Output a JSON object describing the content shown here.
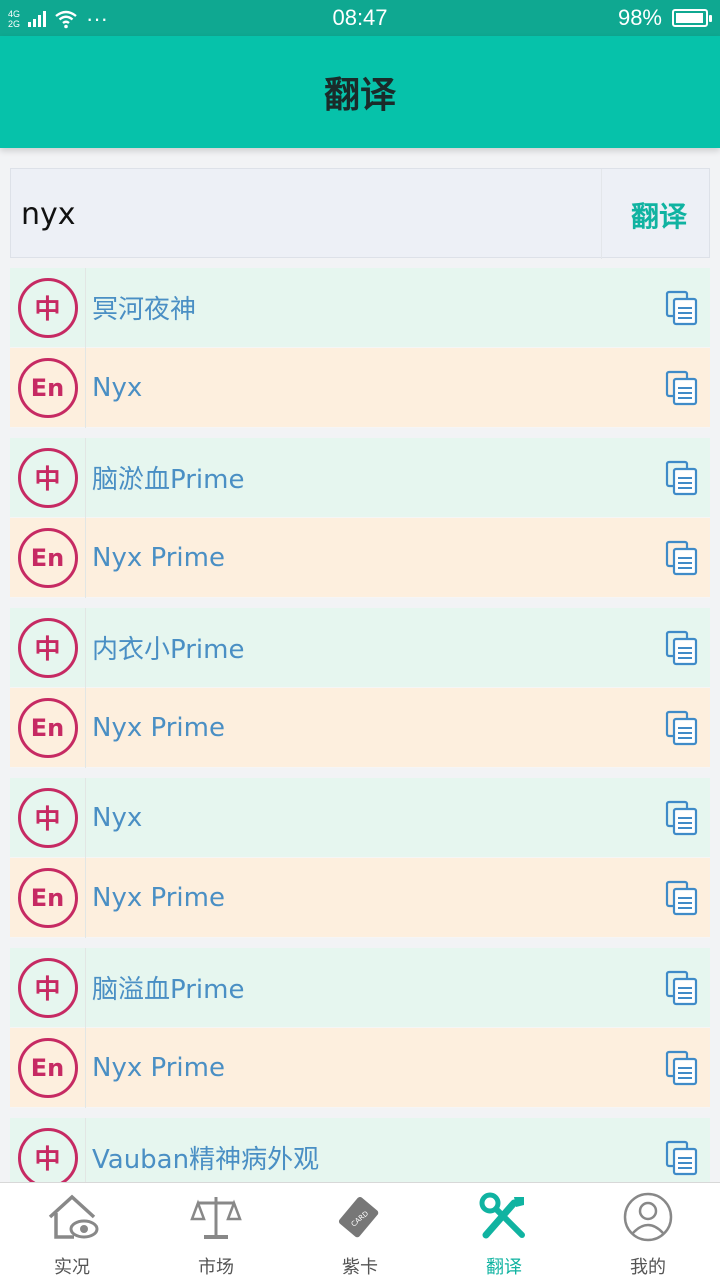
{
  "status_bar": {
    "network_top": "4G",
    "network_bottom": "2G",
    "dots": "···",
    "time": "08:47",
    "battery": "98%",
    "battery_level": 0.98
  },
  "header": {
    "title": "翻译"
  },
  "search": {
    "query": "nyx",
    "button_label": "翻译"
  },
  "results": [
    {
      "zh": "冥河夜神",
      "en": "Nyx"
    },
    {
      "zh": "脑淤血Prime",
      "en": "Nyx Prime"
    },
    {
      "zh": "内衣小Prime",
      "en": "Nyx Prime"
    },
    {
      "zh": "Nyx",
      "en": "Nyx Prime"
    },
    {
      "zh": "脑溢血Prime",
      "en": "Nyx Prime"
    },
    {
      "zh": "Vauban精神病外观",
      "en": ""
    }
  ],
  "badges": {
    "zh": "中",
    "en": "En"
  },
  "nav": [
    {
      "label": "实况",
      "icon": "home-eye-icon",
      "active": false
    },
    {
      "label": "市场",
      "icon": "scale-icon",
      "active": false
    },
    {
      "label": "紫卡",
      "icon": "card-icon",
      "active": false
    },
    {
      "label": "翻译",
      "icon": "tools-icon",
      "active": true
    },
    {
      "label": "我的",
      "icon": "user-icon",
      "active": false
    }
  ],
  "colors": {
    "accent": "#06c2aa",
    "badge": "#c62a63",
    "zh_row": "#e6f6ef",
    "en_row": "#fdefde",
    "link_text": "#4a8fc4"
  }
}
